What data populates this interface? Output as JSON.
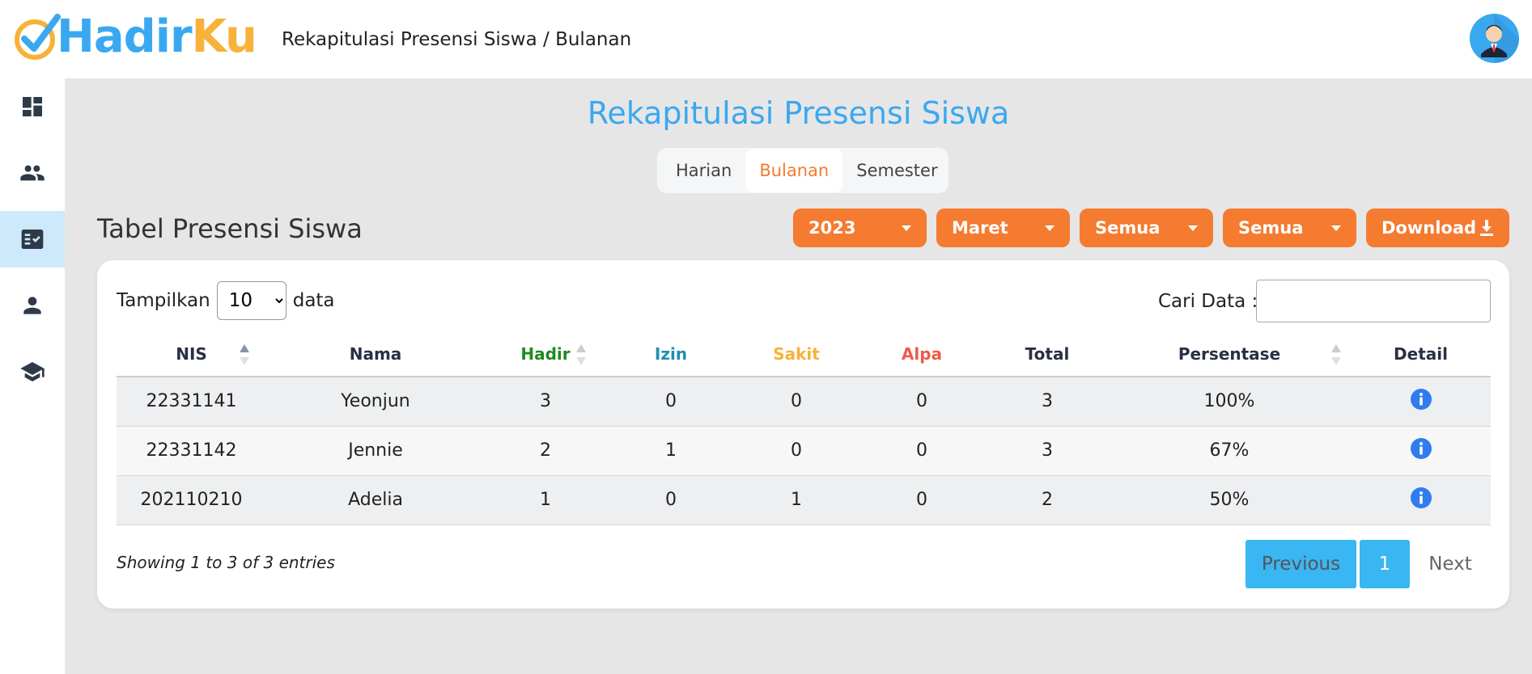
{
  "app": {
    "logo_part1": "Hadir",
    "logo_part2": "Ku",
    "breadcrumb": "Rekapitulasi Presensi Siswa / Bulanan"
  },
  "sidebar": {
    "items": [
      {
        "icon": "dashboard-icon",
        "active": false
      },
      {
        "icon": "group-icon",
        "active": false
      },
      {
        "icon": "attendance-checklist-icon",
        "active": true
      },
      {
        "icon": "person-icon",
        "active": false
      },
      {
        "icon": "graduation-cap-icon",
        "active": false
      }
    ]
  },
  "page": {
    "heading": "Rekapitulasi Presensi Siswa",
    "section_title": "Tabel Presensi Siswa"
  },
  "tabs": [
    {
      "label": "Harian"
    },
    {
      "label": "Bulanan",
      "active": true
    },
    {
      "label": "Semester"
    }
  ],
  "filters": {
    "year": "2023",
    "month": "Maret",
    "filter3": "Semua",
    "filter4": "Semua",
    "download": "Download"
  },
  "table_controls": {
    "show_label": "Tampilkan",
    "page_size": "10",
    "page_size_options": [
      "10"
    ],
    "data_label": "data",
    "search_label": "Cari Data :",
    "search_value": ""
  },
  "table": {
    "headers": [
      "NIS",
      "Nama",
      "Hadir",
      "Izin",
      "Sakit",
      "Alpa",
      "Total",
      "Persentase",
      "Detail"
    ],
    "rows": [
      {
        "nis": "22331141",
        "nama": "Yeonjun",
        "hadir": "3",
        "izin": "0",
        "sakit": "0",
        "alpa": "0",
        "total": "3",
        "persentase": "100%"
      },
      {
        "nis": "22331142",
        "nama": "Jennie",
        "hadir": "2",
        "izin": "1",
        "sakit": "0",
        "alpa": "0",
        "total": "3",
        "persentase": "67%"
      },
      {
        "nis": "202110210",
        "nama": "Adelia",
        "hadir": "1",
        "izin": "0",
        "sakit": "1",
        "alpa": "0",
        "total": "2",
        "persentase": "50%"
      }
    ]
  },
  "footer": {
    "entries_text": "Showing 1 to 3 of 3 entries",
    "prev": "Previous",
    "page": "1",
    "next": "Next"
  },
  "colors": {
    "accent_blue": "#3aa8f0",
    "accent_orange": "#f47b30",
    "hadir": "#1e8a1e",
    "izin": "#1f8fb0",
    "sakit": "#f7b23a",
    "alpa": "#f05a4a"
  }
}
